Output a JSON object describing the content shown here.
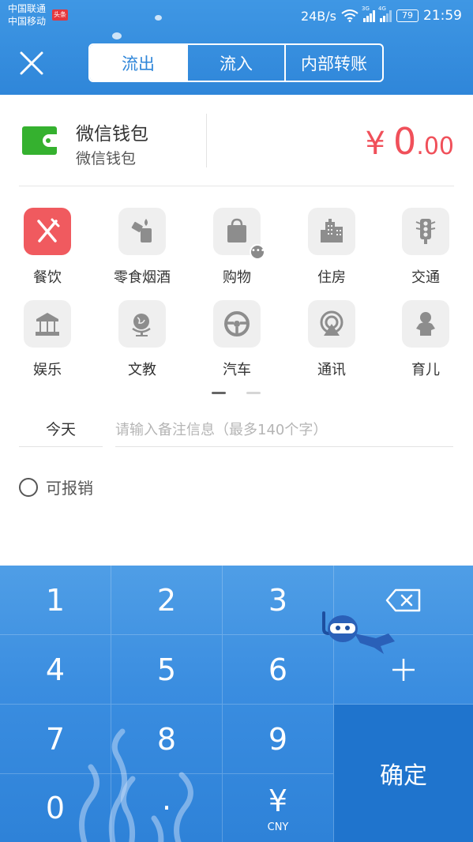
{
  "status_bar": {
    "carrier_1": "中国联通",
    "carrier_2": "中国移动",
    "news_badge": "头条",
    "net_speed": "24B/s",
    "signal_1_tag": "3G",
    "signal_2_tag": "4G",
    "battery": "79",
    "time": "21:59"
  },
  "header": {
    "close_icon": "close-icon",
    "tabs": [
      {
        "label": "流出",
        "active": true
      },
      {
        "label": "流入",
        "active": false
      },
      {
        "label": "内部转账",
        "active": false
      }
    ]
  },
  "account": {
    "icon": "wallet-icon",
    "name": "微信钱包",
    "subtitle": "微信钱包",
    "currency_symbol": "¥",
    "amount_int": "0",
    "amount_dec": ".00",
    "amount_color": "#f0505a"
  },
  "categories": [
    {
      "label": "餐饮",
      "icon": "fork-knife-icon",
      "active": true
    },
    {
      "label": "零食烟酒",
      "icon": "lighter-icon",
      "active": false
    },
    {
      "label": "购物",
      "icon": "shopping-bag-icon",
      "active": false
    },
    {
      "label": "住房",
      "icon": "building-icon",
      "active": false
    },
    {
      "label": "交通",
      "icon": "traffic-light-icon",
      "active": false
    },
    {
      "label": "娱乐",
      "icon": "carousel-icon",
      "active": false
    },
    {
      "label": "文教",
      "icon": "globe-icon",
      "active": false
    },
    {
      "label": "汽车",
      "icon": "steering-wheel-icon",
      "active": false
    },
    {
      "label": "通讯",
      "icon": "broadcast-icon",
      "active": false
    },
    {
      "label": "育儿",
      "icon": "baby-icon",
      "active": false
    }
  ],
  "pager": {
    "pages": 2,
    "current": 1
  },
  "note": {
    "date_label": "今天",
    "placeholder": "请输入备注信息（最多140个字）"
  },
  "reimburse": {
    "label": "可报销",
    "checked": false
  },
  "keypad": {
    "keys": [
      "1",
      "2",
      "3",
      "4",
      "5",
      "6",
      "7",
      "8",
      "9",
      "0",
      "·",
      "¥"
    ],
    "currency_code": "CNY",
    "backspace_icon": "backspace-icon",
    "plus_icon": "plus-icon",
    "confirm_label": "确定"
  },
  "colors": {
    "header_blue": "#2f86d9",
    "active_category": "#f05a5f",
    "wallet_green": "#35b12f",
    "confirm_blue": "#1f74cd"
  }
}
